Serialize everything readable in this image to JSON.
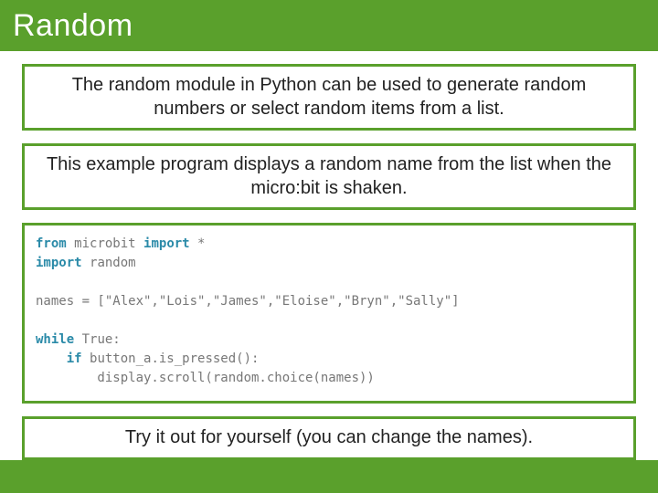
{
  "title": "Random",
  "box1": "The random module in Python can be used to generate random numbers or select random items from a list.",
  "box2": "This example program displays a random name from the list when the micro:bit is shaken.",
  "box3": "Try it out for yourself (you can change the names).",
  "code": {
    "kw_from": "from",
    "mod1": "microbit",
    "kw_import1": "import",
    "star": "*",
    "kw_import2": "import",
    "mod2": "random",
    "names_line": "names = [\"Alex\",\"Lois\",\"James\",\"Eloise\",\"Bryn\",\"Sally\"]",
    "kw_while": "while",
    "true_colon": "True:",
    "kw_if": "if",
    "cond": "button_a.is_pressed():",
    "body": "        display.scroll(random.choice(names))"
  }
}
